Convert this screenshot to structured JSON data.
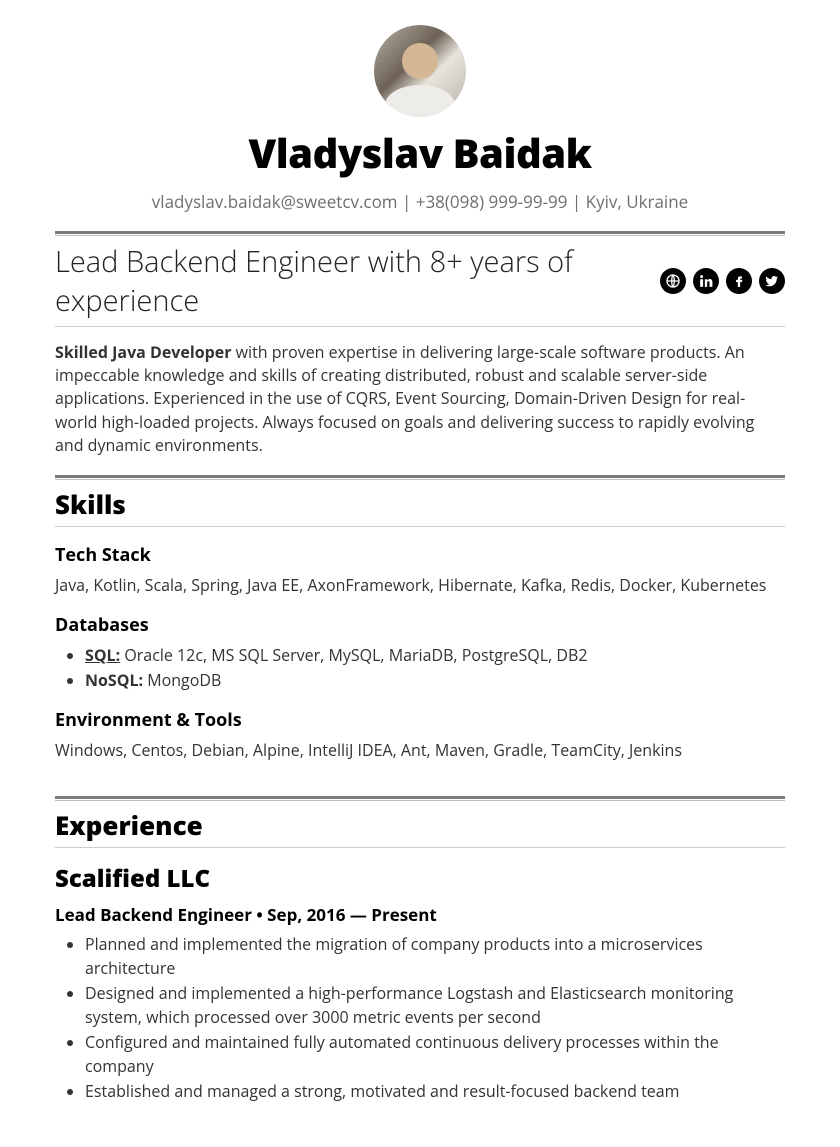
{
  "header": {
    "name": "Vladyslav Baidak",
    "email": "vladyslav.baidak@sweetcv.com",
    "phone": "+38(098) 999-99-99",
    "location": "Kyiv, Ukraine"
  },
  "headline": "Lead Backend Engineer with 8+ years of experience",
  "social_icons": [
    "globe",
    "linkedin",
    "facebook",
    "twitter"
  ],
  "summary": {
    "lead": "Skilled Java Developer",
    "rest": " with proven expertise in delivering large-scale software products. An impeccable knowledge and skills of creating distributed, robust and scalable server-side applications. Experienced in the use of CQRS, Event Sourcing, Domain-Driven Design for real-world high-loaded projects. Always focused on goals and delivering success to rapidly evolving and dynamic environments."
  },
  "skills": {
    "title": "Skills",
    "tech_stack": {
      "title": "Tech Stack",
      "content": "Java, Kotlin, Scala, Spring, Java EE, AxonFramework, Hibernate, Kafka, Redis, Docker, Kubernetes"
    },
    "databases": {
      "title": "Databases",
      "sql_label": "SQL:",
      "sql": " Oracle 12c, MS SQL Server, MySQL, MariaDB, PostgreSQL, DB2",
      "nosql_label": "NoSQL:",
      "nosql": " MongoDB"
    },
    "env_tools": {
      "title": "Environment & Tools",
      "content": "Windows, Centos, Debian, Alpine, IntelliJ IDEA, Ant, Maven, Gradle, TeamCity, Jenkins"
    }
  },
  "experience": {
    "title": "Experience",
    "company": "Scalified LLC",
    "position": "Lead Backend Engineer",
    "separator": " • ",
    "dates": "Sep, 2016 — Present",
    "bullets": [
      "Planned and implemented the migration of company products into a microservices architecture",
      "Designed and implemented a high-performance Logstash and Elasticsearch monitoring system, which processed over 3000 metric events per second",
      "Configured and maintained fully automated continuous delivery processes within the company",
      "Established and managed a strong, motivated and result-focused backend team"
    ]
  }
}
